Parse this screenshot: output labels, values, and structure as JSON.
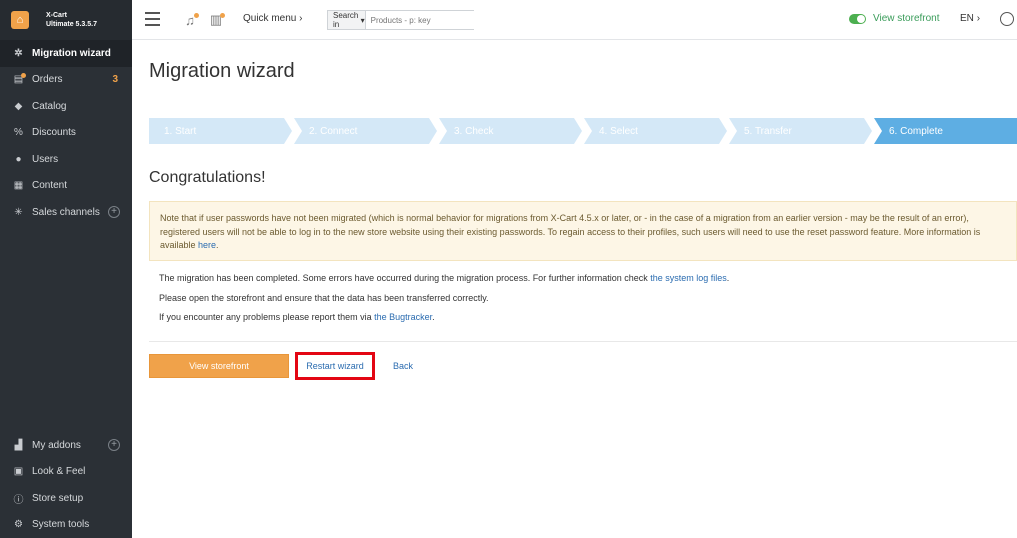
{
  "brand": {
    "name": "X-Cart",
    "edition": "Ultimate 5.3.5.7"
  },
  "sidebar": {
    "items": [
      {
        "label": "Migration wizard",
        "icon": "wizard-icon"
      },
      {
        "label": "Orders",
        "icon": "orders-icon",
        "badge": "3"
      },
      {
        "label": "Catalog",
        "icon": "tag-icon"
      },
      {
        "label": "Discounts",
        "icon": "discount-icon"
      },
      {
        "label": "Users",
        "icon": "users-icon"
      },
      {
        "label": "Content",
        "icon": "content-icon"
      },
      {
        "label": "Sales channels",
        "icon": "network-icon"
      }
    ],
    "bottom_items": [
      {
        "label": "My addons",
        "icon": "puzzle-icon"
      },
      {
        "label": "Look & Feel",
        "icon": "image-icon"
      },
      {
        "label": "Store setup",
        "icon": "info-icon"
      },
      {
        "label": "System tools",
        "icon": "gear-icon"
      }
    ]
  },
  "header": {
    "quick_menu": "Quick menu",
    "search_in": "Search in",
    "search_placeholder": "Products - p: key",
    "view_storefront": "View storefront",
    "language": "EN"
  },
  "main": {
    "title": "Migration wizard",
    "steps": [
      "1. Start",
      "2. Connect",
      "3. Check",
      "4. Select",
      "5. Transfer",
      "6. Complete"
    ],
    "active_step": 6,
    "heading": "Congratulations!",
    "notice_text": "Note that if user passwords have not been migrated (which is normal behavior for migrations from X-Cart 4.5.x or later, or - in the case of a migration from an earlier version - may be the result of an error), registered users will not be able to log in to the new store website using their existing passwords. To regain access to their profiles, such users will need to use the reset password feature. More information is available ",
    "notice_link": "here",
    "notice_end": ".",
    "info_1": "The migration has been completed. Some errors have occurred during the migration process. For further information check ",
    "info_1_link": "the system log files",
    "info_1_end": ".",
    "info_2": "Please open the storefront and ensure that the data has been transferred correctly.",
    "info_3": "If you encounter any problems please report them via ",
    "info_3_link": "the Bugtracker",
    "info_3_end": ".",
    "btn_view_storefront": "View storefront",
    "btn_restart": "Restart wizard",
    "btn_back": "Back"
  }
}
